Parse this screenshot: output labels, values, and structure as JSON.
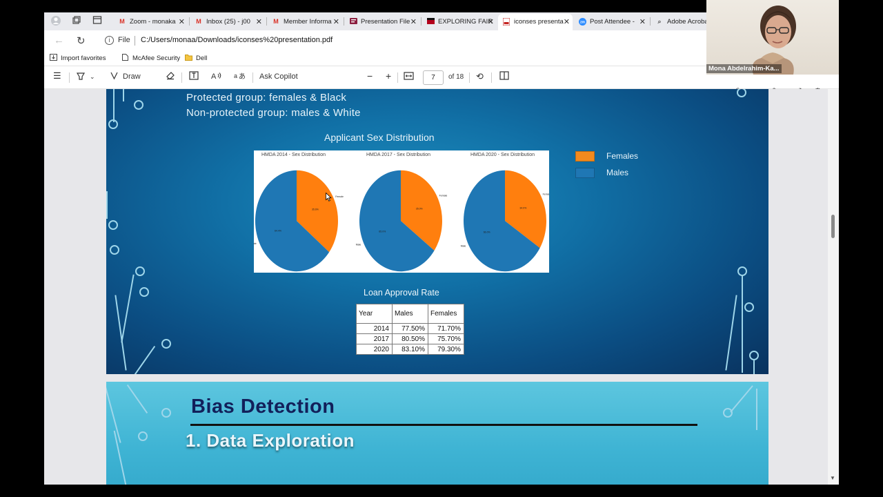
{
  "browser": {
    "tabs": [
      {
        "label": "Zoom - monaka",
        "icon": "gmail-icon",
        "color": "#d93025"
      },
      {
        "label": "Inbox (25) - j00",
        "icon": "gmail-icon",
        "color": "#d93025"
      },
      {
        "label": "Member Informa",
        "icon": "gmail-icon",
        "color": "#d93025"
      },
      {
        "label": "Presentation File",
        "icon": "drive-icon",
        "color": "#777777"
      },
      {
        "label": "EXPLORING FAIR",
        "icon": "pdf-icon",
        "color": "#b3001b"
      },
      {
        "label": "iconses presenta",
        "icon": "pdf-icon",
        "color": "#c5221f"
      },
      {
        "label": "Post Attendee -",
        "icon": "zoom-icon",
        "color": "#2d8cff"
      },
      {
        "label": "Adobe Acroba",
        "icon": "search-icon",
        "color": "#555555"
      }
    ],
    "url_prefix": "File",
    "url": "C:/Users/monaa/Downloads/iconses%20presentation.pdf",
    "favorites": [
      "Import favorites",
      "McAfee Security",
      "Dell"
    ]
  },
  "pdf_toolbar": {
    "draw_label": "Draw",
    "copilot_label": "Ask Copilot",
    "page_current": "7",
    "page_total": "of 18"
  },
  "slide1": {
    "line1": "Protected group: females & Black",
    "line2": "Non-protected group: males & White",
    "chart_title": "Applicant Sex Distribution",
    "legend": [
      {
        "label": "Females",
        "color": "#f28a1e"
      },
      {
        "label": "Males",
        "color": "#1f77b4"
      }
    ],
    "table_title": "Loan Approval Rate",
    "table_headers": [
      "Year",
      "Males",
      "Females"
    ],
    "table_rows": [
      [
        "2014",
        "77.50%",
        "71.70%"
      ],
      [
        "2017",
        "80.50%",
        "75.70%"
      ],
      [
        "2020",
        "83.10%",
        "79.30%"
      ]
    ]
  },
  "chart_data": {
    "type": "pie",
    "charts": [
      {
        "title": "HMDA 2014 - Sex Distribution",
        "labels": [
          "Female",
          "Male"
        ],
        "values": [
          35.6,
          64.4
        ]
      },
      {
        "title": "HMDA 2017 - Sex Distribution",
        "labels": [
          "Female",
          "Male"
        ],
        "values": [
          35.0,
          65.0
        ]
      },
      {
        "title": "HMDA 2020 - Sex Distribution",
        "labels": [
          "Female",
          "Male"
        ],
        "values": [
          34.0,
          66.0
        ]
      }
    ]
  },
  "slide2": {
    "title": "Bias Detection",
    "subtitle": "1. Data Exploration"
  },
  "webcam": {
    "name": "Mona Abdelrahim-Ka..."
  }
}
